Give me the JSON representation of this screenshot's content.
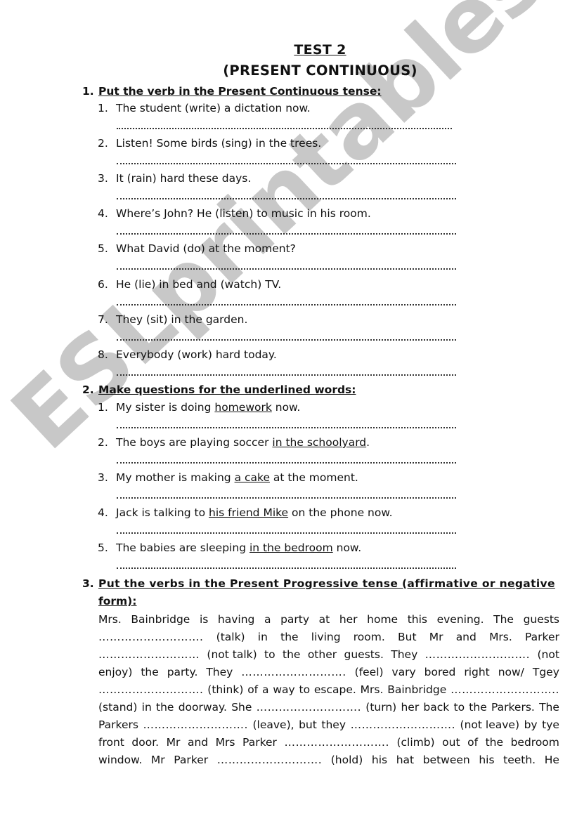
{
  "header": {
    "title": "TEST 2",
    "subtitle": "(PRESENT CONTINUOUS)"
  },
  "watermark": "ESLprintables.com",
  "sections": [
    {
      "number": "1.",
      "instruction": "Put the verb in the Present Continuous tense:",
      "items": [
        {
          "number": "1.",
          "text": "The student (write) a dictation now."
        },
        {
          "number": "2.",
          "text": "Listen! Some birds (sing) in the trees."
        },
        {
          "number": "3.",
          "text": "It (rain) hard these days."
        },
        {
          "number": "4.",
          "text": "Where’s John? He (listen) to music in his room."
        },
        {
          "number": "5.",
          "text": "What David (do) at the moment?"
        },
        {
          "number": "6.",
          "text": "He (lie) in bed and (watch) TV."
        },
        {
          "number": "7.",
          "text": "They (sit) in the garden."
        },
        {
          "number": "8.",
          "text": "Everybody (work) hard today."
        }
      ]
    },
    {
      "number": "2.",
      "instruction": "Make questions for the underlined words:",
      "items": [
        {
          "number": "1.",
          "before": "My sister is doing ",
          "underlined": "homework",
          "after": " now."
        },
        {
          "number": "2.",
          "before": "The boys are playing soccer ",
          "underlined": "in the schoolyard",
          "after": "."
        },
        {
          "number": "3.",
          "before": "My mother is making ",
          "underlined": "a cake",
          "after": " at the moment."
        },
        {
          "number": "4.",
          "before": "Jack is talking to ",
          "underlined": "his friend Mike",
          "after": " on the phone now."
        },
        {
          "number": "5.",
          "before": "The babies are sleeping ",
          "underlined": "in the bedroom",
          "after": " now."
        }
      ]
    },
    {
      "number": "3.",
      "instruction_line1": "Put the verbs in the Present Progressive tense (affirmative or negative",
      "instruction_line2": "form):",
      "paragraph_lines": [
        [
          "Mrs.",
          "Bainbridge",
          "is",
          "having",
          "a",
          "party",
          "at",
          "her",
          "home",
          "this",
          "evening.",
          "The",
          "guests"
        ],
        [
          "……………………….",
          "(talk)",
          "in",
          "the",
          "living",
          "room.",
          "But",
          "Mr",
          "and",
          "Mrs.",
          "Parker"
        ],
        [
          "………………………",
          "(not talk)",
          "to",
          "the",
          "other",
          "guests.",
          "They",
          "……………………….",
          "(not"
        ],
        [
          "enjoy)",
          "the",
          "party.",
          "They",
          "……………………….",
          "(feel)",
          "vary",
          "bored",
          "right",
          "now/",
          "Tgey"
        ],
        [
          "……………………….",
          "(think)",
          "of",
          "a",
          "way",
          "to",
          "escape.",
          "Mrs.",
          "Bainbridge",
          "……………………….."
        ],
        [
          "(stand)",
          "in",
          "the",
          "doorway.",
          "She",
          "……………………….",
          "(turn)",
          "her",
          "back",
          "to",
          "the",
          "Parkers.",
          "The"
        ],
        [
          "Parkers",
          "……………………….",
          "(leave),",
          "but",
          "they",
          "……………………….",
          "(not leave)",
          "by",
          "tye"
        ],
        [
          "front",
          "door.",
          "Mr",
          "and",
          "Mrs",
          "Parker",
          "……………………….",
          "(climb)",
          "out",
          "of",
          "the",
          "bedroom"
        ],
        [
          "window.",
          "Mr",
          "Parker",
          "……………………….",
          "(hold)",
          "his",
          "hat",
          "between",
          "his",
          "teeth.",
          "He"
        ]
      ]
    }
  ]
}
